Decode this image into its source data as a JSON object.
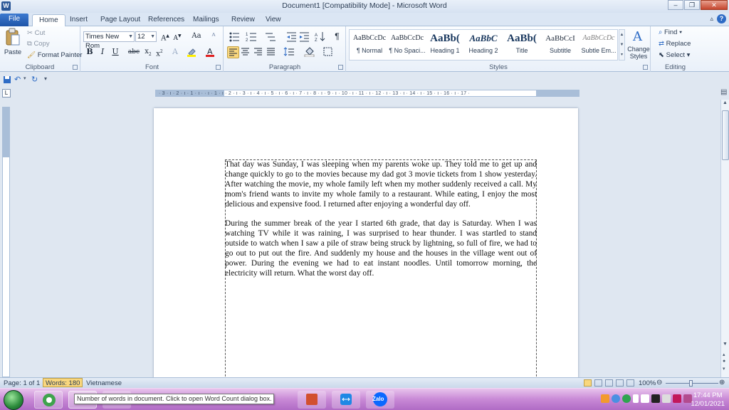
{
  "window": {
    "title": "Document1 [Compatibility Mode] - Microsoft Word",
    "app_icon_letter": "W"
  },
  "tabs": [
    "File",
    "Home",
    "Insert",
    "Page Layout",
    "References",
    "Mailings",
    "Review",
    "View"
  ],
  "ribbon": {
    "clipboard": {
      "label": "Clipboard",
      "paste": "Paste",
      "cut": "Cut",
      "copy": "Copy",
      "format_painter": "Format Painter"
    },
    "font": {
      "label": "Font",
      "font_name": "Times New Rom",
      "font_size": "12",
      "change_case": "Aa"
    },
    "paragraph": {
      "label": "Paragraph"
    },
    "styles": {
      "label": "Styles",
      "items": [
        {
          "preview": "AaBbCcDc",
          "name": "¶ Normal"
        },
        {
          "preview": "AaBbCcDc",
          "name": "¶ No Spaci..."
        },
        {
          "preview": "AaBb(",
          "name": "Heading 1"
        },
        {
          "preview": "AaBbC",
          "name": "Heading 2"
        },
        {
          "preview": "AaBb(",
          "name": "Title"
        },
        {
          "preview": "AaBbCcI",
          "name": "Subtitle"
        },
        {
          "preview": "AaBbCcDc",
          "name": "Subtle Em..."
        }
      ],
      "change_styles": "Change Styles"
    },
    "editing": {
      "label": "Editing",
      "find": "Find",
      "replace": "Replace",
      "select": "Select"
    }
  },
  "ruler": {
    "marks": "· 3 · ı · 2 · ı · 1 · ı ·   · ı · 1 · ı · 2 · ı · 3 · ı · 4 · ı · 5 · ı · 6 · ı · 7 · ı · 8 · ı · 9 · ı · 10 · ı · 11 · ı · 12 · ı · 13 · ı · 14 · ı · 15 · ı · 16 · ı · 17 ·"
  },
  "document": {
    "paragraphs": [
      "That day was Sunday, I was sleeping when my parents woke up. They told me to get up and change quickly to go to the movies because my dad got 3 movie tickets from 1 show yesterday. After watching the movie, my whole family left when my mother suddenly received a call. My mom's friend wants to invite my whole family to a restaurant. While eating, I enjoy the most delicious and expensive food. I returned after enjoying a wonderful day off.",
      "During the summer break of the year I started 6th grade, that day is Saturday. When I was watching TV while it was raining, I was surprised to hear thunder. I was startled to stand outside to watch when I saw a pile of straw being struck by lightning, so full of fire, we had to go out to put out the fire. And suddenly my house and the houses in the village went out of power. During the evening we had to eat instant noodles. Until tomorrow morning, the electricity will return. What the worst day off."
    ]
  },
  "status": {
    "page": "Page: 1 of 1",
    "words": "Words: 180",
    "language": "Vietnamese",
    "zoom": "100%"
  },
  "tooltip": "Number of words in document. Click to open Word Count dialog box.",
  "taskbar": {
    "zalo_label": "Zalo",
    "time": "17:44 PM",
    "date": "12/01/2021"
  }
}
